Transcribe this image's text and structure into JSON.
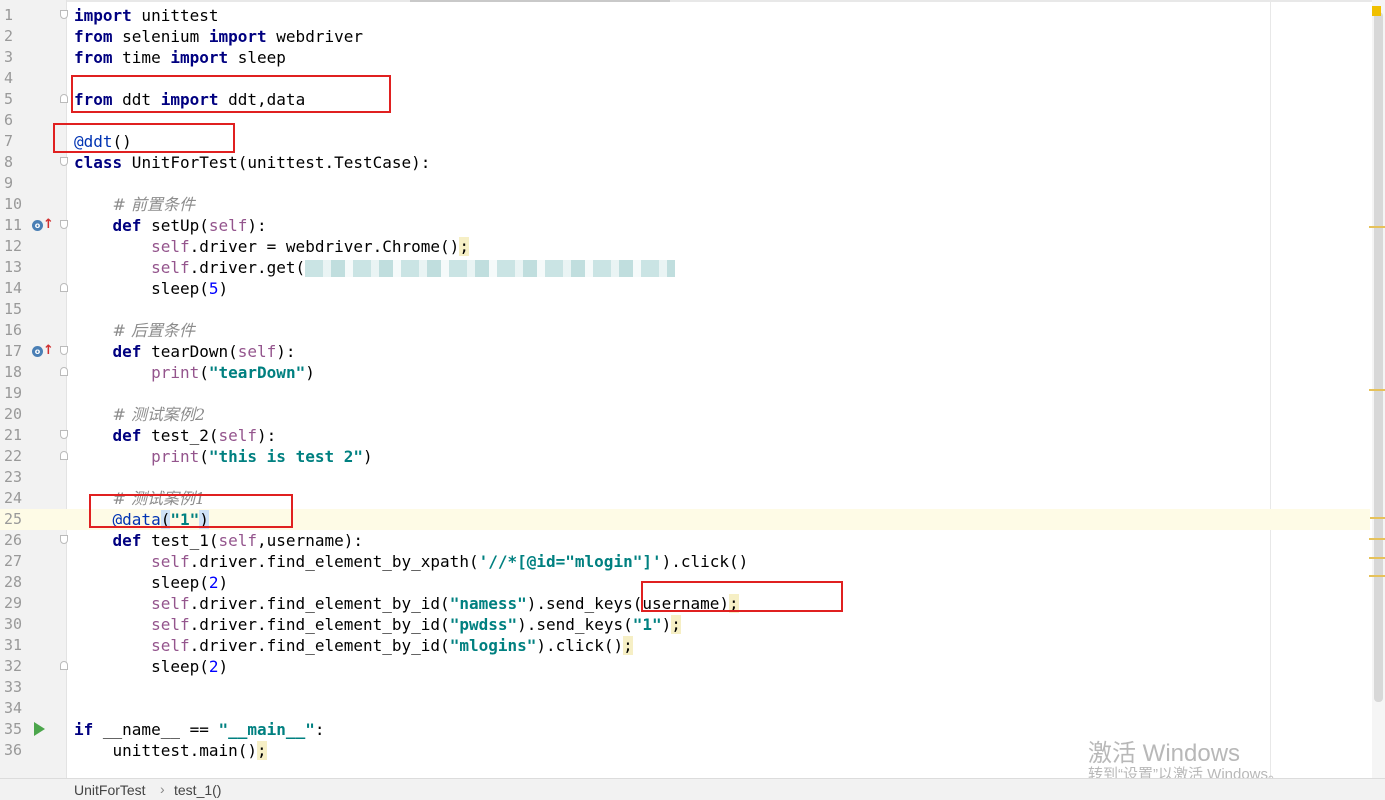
{
  "editor": {
    "line_numbers": [
      "1",
      "2",
      "3",
      "4",
      "5",
      "6",
      "7",
      "8",
      "9",
      "10",
      "11",
      "12",
      "13",
      "14",
      "15",
      "16",
      "17",
      "18",
      "19",
      "20",
      "21",
      "22",
      "23",
      "24",
      "25",
      "26",
      "27",
      "28",
      "29",
      "30",
      "31",
      "32",
      "33",
      "34",
      "35",
      "36"
    ],
    "tokens": {
      "l1_kw": "import",
      "l1_rest": " unittest",
      "l2_kw1": "from",
      "l2_mod": " selenium ",
      "l2_kw2": "import",
      "l2_rest": " webdriver",
      "l3_kw1": "from",
      "l3_mod": " time ",
      "l3_kw2": "import",
      "l3_rest": " sleep",
      "l5_kw1": "from",
      "l5_mod": " ddt ",
      "l5_kw2": "import",
      "l5_rest": " ddt,data",
      "l7_deco": "@ddt",
      "l7_rest": "()",
      "l8_kw": "class",
      "l8_rest": " UnitForTest(unittest.TestCase):",
      "l10_cmt": "# 前置条件",
      "l11_kw": "def",
      "l11_a": " setUp(",
      "l11_self": "self",
      "l11_b": "):",
      "l12_self": "self",
      "l12_a": ".driver = webdriver.Chrome()",
      "l12_semi": ";",
      "l13_self": "self",
      "l13_a": ".driver.get(",
      "l14_a": "sleep(",
      "l14_num": "5",
      "l14_b": ")",
      "l16_cmt": "# 后置条件",
      "l17_kw": "def",
      "l17_a": " tearDown(",
      "l17_self": "self",
      "l17_b": "):",
      "l18_self": "print",
      "l18_a": "(",
      "l18_str": "\"tearDown\"",
      "l18_b": ")",
      "l20_cmt": "# 测试案例2",
      "l21_kw": "def",
      "l21_a": " test_2(",
      "l21_self": "self",
      "l21_b": "):",
      "l22_self": "print",
      "l22_a": "(",
      "l22_str": "\"this is test 2\"",
      "l22_b": ")",
      "l24_cmt": "# 测试案例1",
      "l25_deco": "@data",
      "l25_brk1": "(",
      "l25_str": "\"1\"",
      "l25_brk2": ")",
      "l26_kw": "def",
      "l26_a": " test_1(",
      "l26_self": "self",
      "l26_b": ",username):",
      "l27_self": "self",
      "l27_a": ".driver.find_element_by_xpath(",
      "l27_str": "'//*[@id=\"mlogin\"]'",
      "l27_b": ").click()",
      "l28_a": "sleep(",
      "l28_num": "2",
      "l28_b": ")",
      "l29_self": "self",
      "l29_a": ".driver.find_element_by_id(",
      "l29_str": "\"namess\"",
      "l29_b": ").send_keys(username)",
      "l29_semi": ";",
      "l30_self": "self",
      "l30_a": ".driver.find_element_by_id(",
      "l30_str": "\"pwdss\"",
      "l30_b": ").send_keys(",
      "l30_str2": "\"1\"",
      "l30_c": ")",
      "l30_semi": ";",
      "l31_self": "self",
      "l31_a": ".driver.find_element_by_id(",
      "l31_str": "\"mlogins\"",
      "l31_b": ").click()",
      "l31_semi": ";",
      "l32_a": "sleep(",
      "l32_num": "2",
      "l32_b": ")",
      "l35_kw": "if",
      "l35_a": " __name__ == ",
      "l35_str": "\"__main__\"",
      "l35_b": ":",
      "l36_a": "unittest.main()",
      "l36_semi": ";"
    }
  },
  "breadcrumb": {
    "class_name": "UnitForTest",
    "separator": "›",
    "method_name": "test_1()"
  },
  "watermark": {
    "title": "激活 Windows",
    "subtitle": "转到“设置”以激活 Windows。"
  },
  "colors": {
    "keyword": "#000080",
    "self": "#94558d",
    "number": "#0000ff",
    "string": "#008080",
    "comment": "#8c8c8c",
    "annotation_box": "#e02020",
    "current_line": "#fefbe6"
  },
  "icons": {
    "override": "override-up-arrow-icon",
    "run": "run-triangle-icon",
    "fold": "fold-marker-icon"
  }
}
